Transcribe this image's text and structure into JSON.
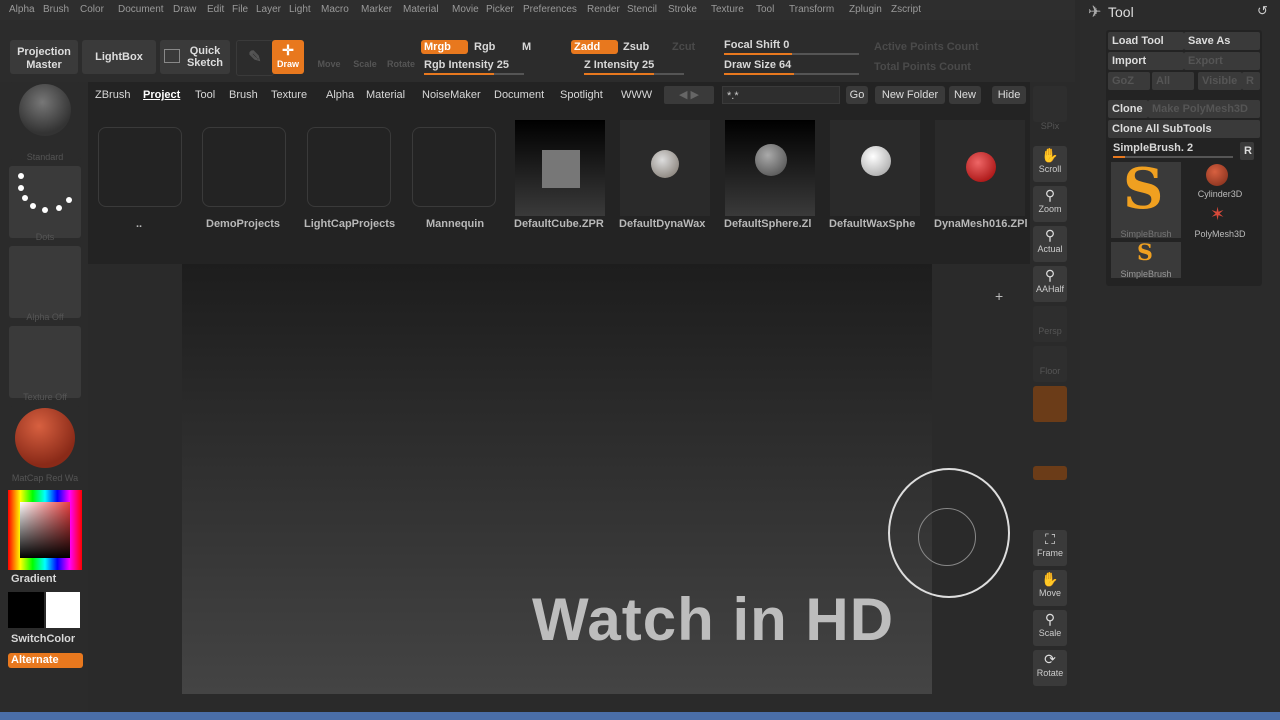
{
  "menu": [
    "Alpha",
    "Brush",
    "Color",
    "Document",
    "Draw",
    "Edit",
    "File",
    "Layer",
    "Light",
    "Macro",
    "Marker",
    "Material",
    "Movie",
    "Picker",
    "Preferences",
    "Render",
    "Stencil",
    "Stroke",
    "Texture",
    "Tool",
    "Transform",
    "Zplugin",
    "Zscript"
  ],
  "shelf": {
    "projection_master": "Projection Master",
    "lightbox": "LightBox",
    "quick_sketch": "Quick Sketch",
    "draw": "Draw",
    "move": "Move",
    "scale": "Scale",
    "rotate": "Rotate",
    "mrgb": "Mrgb",
    "rgb": "Rgb",
    "m": "M",
    "zadd": "Zadd",
    "zsub": "Zsub",
    "zcut": "Zcut",
    "rgb_intensity": "Rgb Intensity 25",
    "z_intensity": "Z Intensity 25",
    "focal_shift": "Focal Shift 0",
    "draw_size": "Draw Size 64",
    "active_points": "Active Points Count",
    "total_points": "Total Points Count",
    "rgb_intensity_value": 25,
    "z_intensity_value": 25,
    "focal_shift_value": 0,
    "draw_size_value": 64
  },
  "lightbox": {
    "tabs": [
      "ZBrush",
      "Project",
      "Tool",
      "Brush",
      "Texture",
      "Alpha",
      "Material",
      "NoiseMaker",
      "Document",
      "Spotlight",
      "WWW"
    ],
    "active_tab": "Project",
    "path": "*.*",
    "go": "Go",
    "new_folder": "New Folder",
    "new": "New",
    "hide": "Hide",
    "items": [
      "..",
      "DemoProjects",
      "LightCapProjects",
      "Mannequin",
      "DefaultCube.ZPR",
      "DefaultDynaWax",
      "DefaultSphere.Zl",
      "DefaultWaxSphe",
      "DynaMesh016.ZPl"
    ]
  },
  "left": {
    "standard": "Standard",
    "dots": "Dots",
    "alpha_off": "Alpha Off",
    "texture_off": "Texture Off",
    "matcap": "MatCap Red Wa",
    "gradient": "Gradient",
    "switch_color": "SwitchColor",
    "alternate": "Alternate"
  },
  "right_strip": {
    "spix": "SPix",
    "scroll": "Scroll",
    "zoom": "Zoom",
    "actual": "Actual",
    "aahalf": "AAHalf",
    "persp": "Persp",
    "floor": "Floor",
    "frame": "Frame",
    "move": "Move",
    "scale": "Scale",
    "rotate": "Rotate"
  },
  "overlay": "Watch in HD",
  "tool": {
    "title": "Tool",
    "load_tool": "Load Tool",
    "save_as": "Save As",
    "import": "Import",
    "export": "Export",
    "goz": "GoZ",
    "all": "All",
    "visible": "Visible",
    "r": "R",
    "clone": "Clone",
    "make_polymesh": "Make PolyMesh3D",
    "clone_all": "Clone All SubTools",
    "current": "SimpleBrush. 2",
    "r2": "R",
    "thumbs": [
      "SimpleBrush",
      "Cylinder3D",
      "PolyMesh3D",
      "SimpleBrush"
    ]
  },
  "colors": {
    "accent": "#e8781e"
  }
}
